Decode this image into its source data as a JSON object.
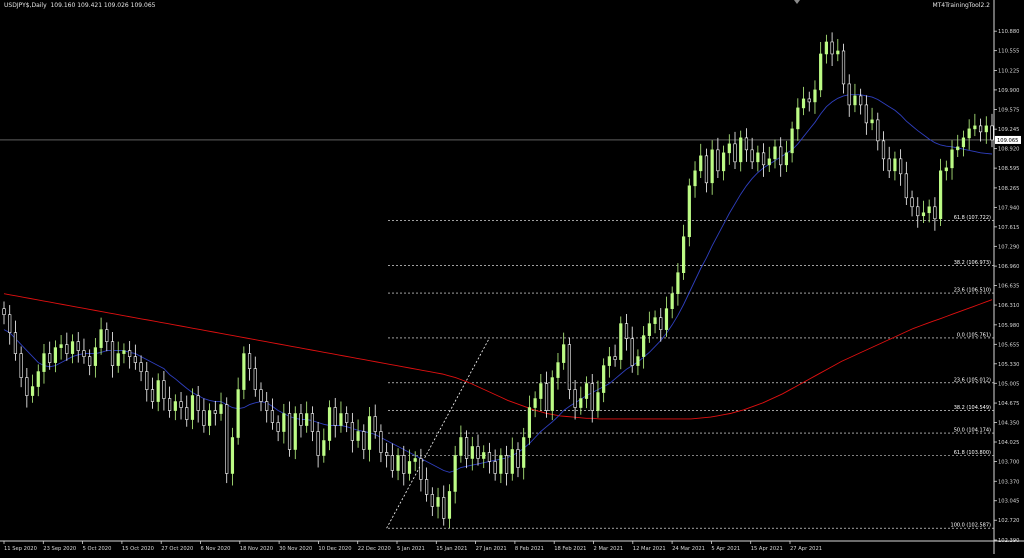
{
  "header": {
    "symbol_timeframe": "USDJPY$,Daily",
    "ohlc": "109.160 109.421 109.026 109.065",
    "tool_name": "MT4TrainingTool2.2"
  },
  "colors": {
    "background": "#000000",
    "bull_candle": "#bdfc86",
    "bear_candle": "#ffffff",
    "ma_fast": "#2f3fbf",
    "ma_slow": "#e01010",
    "fib_line": "#ffffff",
    "axis": "#d8d8d8",
    "current_price_line": "#9a9a9a"
  },
  "chart_data": {
    "type": "candlestick",
    "title": "USDJPY$,Daily",
    "y_ticks": [
      "110.880",
      "110.555",
      "110.225",
      "109.900",
      "109.575",
      "109.245",
      "108.920",
      "108.595",
      "108.265",
      "107.940",
      "107.615",
      "107.290",
      "106.960",
      "106.635",
      "106.310",
      "105.980",
      "105.655",
      "105.330",
      "105.005",
      "104.675",
      "104.350",
      "104.025",
      "103.700",
      "103.370",
      "103.045",
      "102.720",
      "102.390"
    ],
    "x_ticks": [
      "11 Sep 2020",
      "23 Sep 2020",
      "5 Oct 2020",
      "15 Oct 2020",
      "27 Oct 2020",
      "6 Nov 2020",
      "18 Nov 2020",
      "30 Nov 2020",
      "10 Dec 2020",
      "22 Dec 2020",
      "5 Jan 2021",
      "15 Jan 2021",
      "27 Jan 2021",
      "8 Feb 2021",
      "18 Feb 2021",
      "2 Mar 2021",
      "12 Mar 2021",
      "24 Mar 2021",
      "5 Apr 2021",
      "15 Apr 2021",
      "27 Apr 2021"
    ],
    "ylim": [
      102.39,
      111.2
    ],
    "current_price": "109.065",
    "grid": false,
    "series": [
      {
        "name": "USDJPY$",
        "kind": "price",
        "close": [
          106.15,
          105.85,
          105.5,
          105.1,
          104.8,
          104.95,
          105.2,
          105.5,
          105.35,
          105.6,
          105.65,
          105.5,
          105.7,
          105.55,
          105.45,
          105.3,
          105.6,
          105.9,
          105.7,
          105.3,
          105.5,
          105.55,
          105.45,
          105.35,
          105.2,
          104.9,
          104.7,
          105.05,
          104.75,
          104.55,
          104.7,
          104.6,
          104.4,
          104.8,
          104.55,
          104.3,
          104.55,
          104.5,
          104.65,
          103.5,
          104.1,
          104.9,
          105.5,
          105.25,
          104.9,
          104.7,
          104.55,
          104.35,
          104.2,
          104.5,
          103.9,
          104.5,
          104.3,
          104.5,
          104.2,
          103.8,
          104.05,
          104.6,
          104.3,
          104.5,
          104.35,
          104.05,
          104.2,
          103.9,
          104.45,
          104.2,
          103.85,
          103.8,
          103.55,
          103.8,
          103.5,
          103.7,
          103.75,
          103.4,
          103.15,
          102.95,
          103.1,
          102.75,
          103.2,
          103.8,
          104.1,
          103.75,
          103.95,
          103.75,
          103.85,
          103.7,
          103.5,
          103.8,
          103.5,
          103.9,
          103.6,
          104.1,
          104.6,
          104.75,
          105.0,
          104.55,
          105.1,
          105.35,
          105.65,
          104.9,
          104.6,
          104.75,
          105.0,
          104.55,
          104.85,
          105.3,
          105.45,
          105.4,
          106.0,
          105.75,
          105.3,
          105.45,
          105.8,
          106.0,
          106.1,
          105.9,
          106.25,
          106.5,
          106.85,
          107.45,
          108.3,
          108.55,
          108.8,
          108.35,
          108.9,
          108.55,
          108.85,
          109.0,
          108.7,
          109.1,
          108.9,
          108.7,
          108.85,
          108.65,
          108.75,
          108.95,
          108.65,
          108.85,
          109.25,
          109.6,
          109.75,
          109.7,
          109.9,
          110.5,
          110.7,
          110.5,
          110.55,
          110.0,
          109.65,
          109.8,
          109.65,
          109.35,
          109.4,
          109.05,
          108.75,
          108.55,
          108.75,
          108.5,
          108.1,
          107.95,
          107.8,
          107.85,
          107.95,
          107.75,
          108.55,
          108.6,
          108.9,
          108.95,
          109.1,
          109.25,
          109.3,
          109.2,
          109.3,
          109.065
        ]
      },
      {
        "name": "MA fast",
        "kind": "ma",
        "values": [
          105.9,
          105.85,
          105.75,
          105.65,
          105.55,
          105.45,
          105.35,
          105.3,
          105.28,
          105.3,
          105.35,
          105.4,
          105.45,
          105.48,
          105.5,
          105.5,
          105.5,
          105.52,
          105.55,
          105.55,
          105.55,
          105.55,
          105.52,
          105.5,
          105.45,
          105.4,
          105.35,
          105.3,
          105.25,
          105.15,
          105.08,
          105.0,
          104.92,
          104.85,
          104.8,
          104.75,
          104.72,
          104.7,
          104.7,
          104.65,
          104.6,
          104.58,
          104.6,
          104.65,
          104.68,
          104.7,
          104.68,
          104.62,
          104.55,
          104.5,
          104.45,
          104.42,
          104.4,
          104.4,
          104.38,
          104.35,
          104.32,
          104.3,
          104.3,
          104.3,
          104.28,
          104.25,
          104.22,
          104.2,
          104.18,
          104.15,
          104.1,
          104.05,
          104.0,
          103.95,
          103.9,
          103.85,
          103.8,
          103.75,
          103.7,
          103.65,
          103.6,
          103.55,
          103.52,
          103.55,
          103.6,
          103.62,
          103.64,
          103.66,
          103.68,
          103.7,
          103.72,
          103.74,
          103.76,
          103.8,
          103.85,
          103.92,
          104.0,
          104.1,
          104.2,
          104.28,
          104.36,
          104.45,
          104.55,
          104.62,
          104.68,
          104.74,
          104.8,
          104.85,
          104.9,
          104.95,
          105.0,
          105.08,
          105.16,
          105.24,
          105.3,
          105.36,
          105.44,
          105.52,
          105.62,
          105.72,
          105.84,
          105.98,
          106.14,
          106.32,
          106.52,
          106.72,
          106.92,
          107.1,
          107.3,
          107.48,
          107.66,
          107.84,
          108.0,
          108.16,
          108.3,
          108.42,
          108.52,
          108.6,
          108.66,
          108.72,
          108.78,
          108.84,
          108.9,
          109.0,
          109.12,
          109.24,
          109.36,
          109.5,
          109.62,
          109.7,
          109.76,
          109.8,
          109.82,
          109.82,
          109.82,
          109.8,
          109.78,
          109.74,
          109.68,
          109.62,
          109.56,
          109.48,
          109.38,
          109.3,
          109.22,
          109.15,
          109.08,
          109.02,
          108.98,
          108.96,
          108.95,
          108.93,
          108.91,
          108.89,
          108.87,
          108.85,
          108.84,
          108.83
        ]
      },
      {
        "name": "MA slow",
        "kind": "ma",
        "values": [
          106.5,
          106.48,
          106.46,
          106.44,
          106.42,
          106.4,
          106.38,
          106.36,
          106.34,
          106.32,
          106.3,
          106.28,
          106.26,
          106.24,
          106.22,
          106.2,
          106.18,
          106.16,
          106.14,
          106.12,
          106.1,
          106.08,
          106.06,
          106.04,
          106.02,
          106.0,
          105.98,
          105.96,
          105.94,
          105.92,
          105.9,
          105.88,
          105.86,
          105.84,
          105.82,
          105.8,
          105.78,
          105.76,
          105.74,
          105.72,
          105.7,
          105.68,
          105.66,
          105.64,
          105.62,
          105.6,
          105.58,
          105.56,
          105.54,
          105.52,
          105.5,
          105.48,
          105.46,
          105.44,
          105.42,
          105.4,
          105.38,
          105.36,
          105.34,
          105.32,
          105.3,
          105.28,
          105.26,
          105.24,
          105.22,
          105.2,
          105.18,
          105.16,
          105.13,
          105.1,
          105.06,
          105.02,
          104.97,
          104.92,
          104.87,
          104.82,
          104.77,
          104.72,
          104.68,
          104.64,
          104.6,
          104.56,
          104.53,
          104.5,
          104.48,
          104.46,
          104.45,
          104.44,
          104.43,
          104.42,
          104.42,
          104.41,
          104.41,
          104.41,
          104.41,
          104.41,
          104.41,
          104.41,
          104.41,
          104.41,
          104.41,
          104.41,
          104.41,
          104.41,
          104.41,
          104.41,
          104.42,
          104.43,
          104.44,
          104.46,
          104.48,
          104.5,
          104.53,
          104.56,
          104.6,
          104.64,
          104.68,
          104.73,
          104.78,
          104.83,
          104.89,
          104.95,
          105.01,
          105.07,
          105.13,
          105.19,
          105.25,
          105.31,
          105.37,
          105.42,
          105.47,
          105.52,
          105.57,
          105.62,
          105.67,
          105.72,
          105.77,
          105.82,
          105.87,
          105.92,
          105.96,
          106.0,
          106.04,
          106.08,
          106.12,
          106.16,
          106.2,
          106.24,
          106.28,
          106.32,
          106.36,
          106.4
        ]
      }
    ],
    "fibonacci": {
      "levels": [
        {
          "label": "61.8 (107.722)",
          "price": 107.722
        },
        {
          "label": "38.2 (106.973)",
          "price": 106.973
        },
        {
          "label": "23.6 (106.510)",
          "price": 106.51
        },
        {
          "label": "0.0 (105.761)",
          "price": 105.761
        },
        {
          "label": "23.6 (105.012)",
          "price": 105.012
        },
        {
          "label": "38.2 (104.549)",
          "price": 104.549
        },
        {
          "label": "50.0 (104.174)",
          "price": 104.174
        },
        {
          "label": "61.8 (103.800)",
          "price": 103.8
        },
        {
          "label": "100.0 (102.587)",
          "price": 102.587
        }
      ],
      "anchor_low": 102.587,
      "anchor_high": 105.761
    }
  }
}
